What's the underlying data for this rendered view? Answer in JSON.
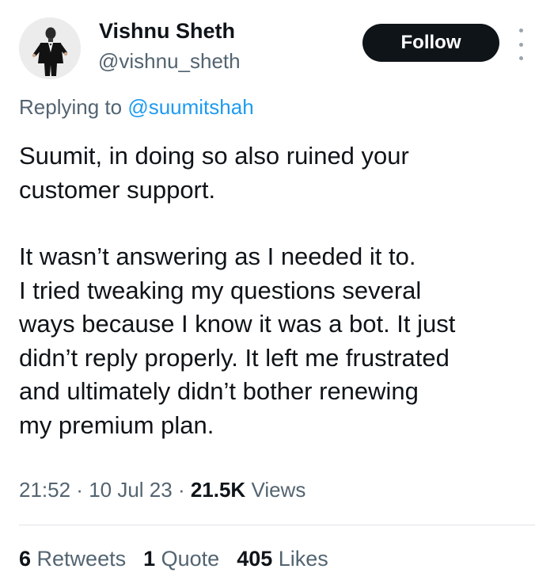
{
  "author": {
    "display_name": "Vishnu Sheth",
    "handle": "@vishnu_sheth",
    "avatar_icon": "tuxedo-man-avatar"
  },
  "actions": {
    "follow_label": "Follow",
    "more_icon": "vertical-ellipsis-icon"
  },
  "reply": {
    "prefix": "Replying to ",
    "mention": "@suumitshah"
  },
  "tweet": {
    "paragraphs": [
      "Suumit, in doing so also ruined your\ncustomer support.",
      "It wasn’t answering as I needed it to.\nI tried tweaking my questions several\nways because I know it was a bot. It just\ndidn’t reply properly. It left me frustrated\nand ultimately didn’t bother renewing\nmy premium plan."
    ]
  },
  "meta": {
    "time": "21:52",
    "separator": " · ",
    "date": "10 Jul 23",
    "views_count": "21.5K",
    "views_label": " Views"
  },
  "stats": {
    "retweets_count": "6",
    "retweets_label": " Retweets",
    "quotes_count": "1",
    "quotes_label": " Quote",
    "likes_count": "405",
    "likes_label": " Likes"
  },
  "colors": {
    "text_primary": "#0f1419",
    "text_secondary": "#536471",
    "accent_link": "#1d9bf0",
    "follow_button_bg": "#0f1419"
  }
}
